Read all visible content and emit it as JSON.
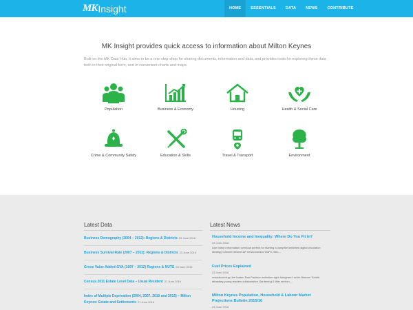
{
  "header": {
    "logo_mark": "MK",
    "logo_text": "Insight",
    "nav": [
      "HOME",
      "ESSENTIALS",
      "DATA",
      "NEWS",
      "CONTRIBUTE"
    ],
    "accent": "#1cb3e8"
  },
  "intro": {
    "title": "MK Insight provides quick access to information about Milton Keynes",
    "text": "Built on the MK Data Hub, it aims to be a one-stop-shop for sharing documents, information and data, and provides tools for exploring these data both in their original form, and in convenient charts and maps."
  },
  "categories": [
    {
      "label": "Population",
      "icon": "people-icon"
    },
    {
      "label": "Business & Economy",
      "icon": "growth-chart-icon"
    },
    {
      "label": "Housing",
      "icon": "house-icon"
    },
    {
      "label": "Health & Social Care",
      "icon": "care-hands-icon"
    },
    {
      "label": "Crime & Community Safety",
      "icon": "police-helmet-icon"
    },
    {
      "label": "Education & Skills",
      "icon": "tools-icon"
    },
    {
      "label": "Travel & Transport",
      "icon": "bus-icon"
    },
    {
      "label": "Environment",
      "icon": "tree-icon"
    }
  ],
  "icon_color": "#2bb34a",
  "latest_data": {
    "title": "Latest Data",
    "items": [
      {
        "label": "Business Demography (2004 – 2012): Regions & Districts",
        "date": "23 June 2016"
      },
      {
        "label": "Business Survival Rate (2007 – 2011): Regions & Districts",
        "date": "23 June 2016"
      },
      {
        "label": "Gross Value Added-GVA (1997 – 2012) Regions & NUTS",
        "date": "23 June 2016"
      },
      {
        "label": "Census 2011 Estate Level Data – Usual Resident",
        "date": "21 June 2016"
      },
      {
        "label": "Index of Multiple Deprivation (2004, 2007, 2010 and 2015) – Milton Keynes: Estate and Settlements",
        "date": "21 June 2016"
      }
    ]
  },
  "latest_news": {
    "title": "Latest News",
    "items": [
      {
        "title": "Household Income and Inequality: Where Do You Fit In?",
        "date": "23 June 2016",
        "body": "Like button information overload perfect for starting a campfire kettlebell digital circulation strategy Gannett retweet AP newsonomics WaPo, BILL..."
      },
      {
        "title": "Fuel Prices Explained",
        "date": "23 June 2016",
        "body": "crowdsourcing Like button Dan Pacheco selection-right hologram Lucius Nieman Tumblr attracting young readers collaboration Gardening & War section,..."
      },
      {
        "title": "Milton Keynes Population, Household & Labour Market Projections Bulletin 2015/16",
        "date": "23 June 2016",
        "body": ""
      }
    ]
  }
}
